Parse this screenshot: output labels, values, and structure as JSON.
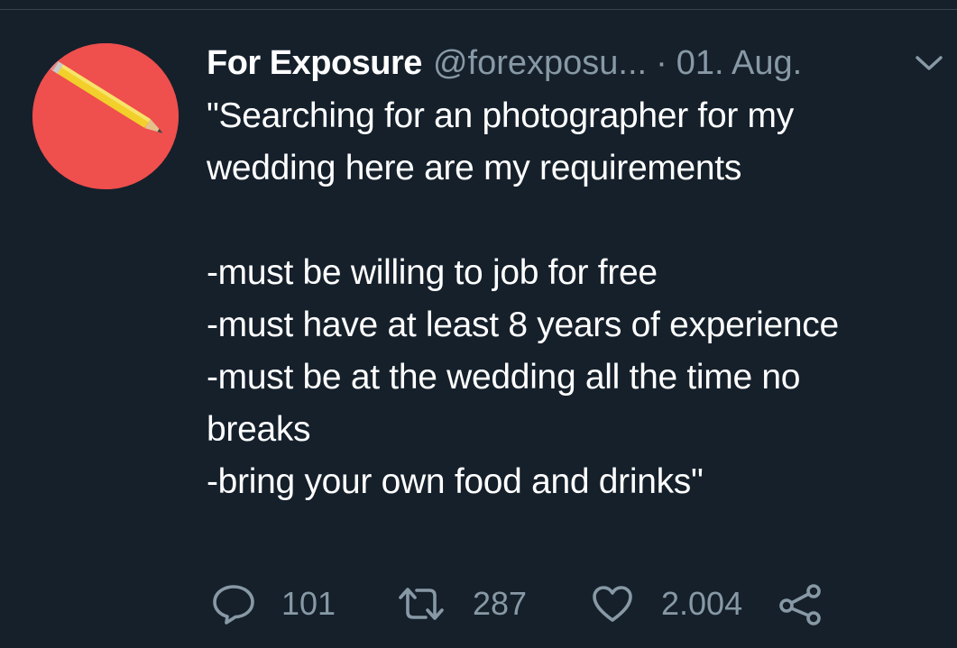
{
  "tweet": {
    "display_name": "For Exposure",
    "handle": "@forexposu...",
    "separator": "·",
    "date": "01. Aug.",
    "text_lines": [
      "\"Searching for an photographer for my",
      "wedding here are my requirements",
      "",
      "-must be willing to job for free",
      "-must have at least 8 years of experience",
      "-must be at the wedding all the time no",
      "breaks",
      "-bring your own food and drinks\""
    ],
    "avatar_color": "#ef4f4d"
  },
  "actions": {
    "reply_count": "101",
    "retweet_count": "287",
    "like_count": "2.004",
    "icons": [
      "reply-icon",
      "retweet-icon",
      "like-icon",
      "share-icon"
    ]
  },
  "colors": {
    "background": "#15202b",
    "text": "#ffffff",
    "secondary": "#8899a6"
  }
}
